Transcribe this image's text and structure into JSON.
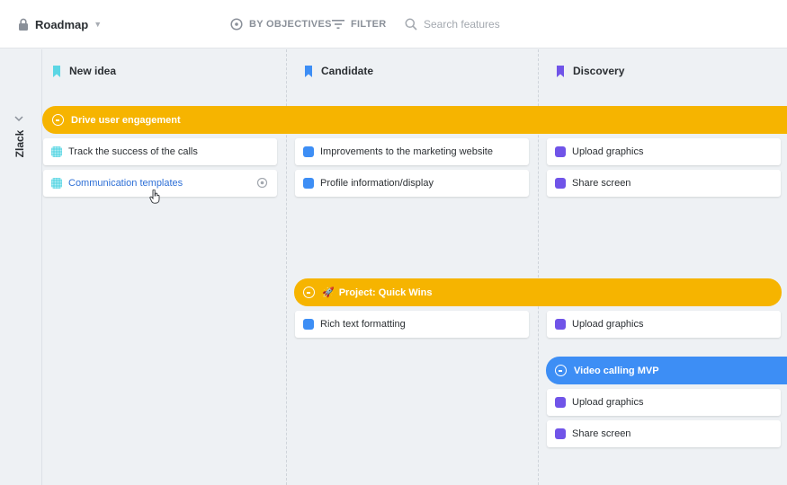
{
  "header": {
    "title": "Roadmap",
    "objectives_label": "BY OBJECTIVES",
    "filter_label": "FILTER",
    "search_placeholder": "Search features"
  },
  "group": {
    "label": "Zlack"
  },
  "columns": [
    {
      "label": "New idea",
      "color": "#5bd6e4"
    },
    {
      "label": "Candidate",
      "color": "#3d8ef5"
    },
    {
      "label": "Discovery",
      "color": "#7054e8"
    }
  ],
  "objectives": [
    {
      "label": "Drive user engagement",
      "color": "#f6b400"
    },
    {
      "label": "Project: Quick Wins",
      "emoji": "🚀",
      "color": "#f6b400"
    },
    {
      "label": "Video calling MVP",
      "color": "#3d8ef5"
    }
  ],
  "cards": {
    "new_idea_1": "Track the success of the calls",
    "new_idea_2": "Communication templates",
    "candidate_1": "Improvements to the marketing website",
    "candidate_2": "Profile information/display",
    "candidate_3": "Rich text formatting",
    "discovery_1": "Upload graphics",
    "discovery_2": "Share screen",
    "discovery_3": "Upload graphics",
    "discovery_4": "Upload graphics",
    "discovery_5": "Share screen"
  }
}
